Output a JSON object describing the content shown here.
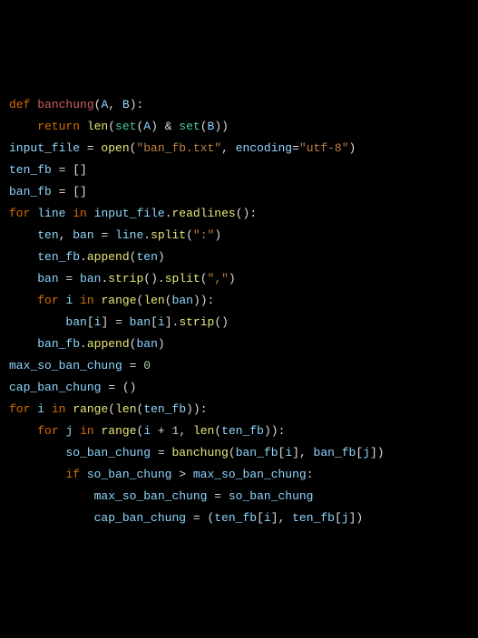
{
  "code": {
    "lines": [
      [
        {
          "cls": "kw-orange",
          "t": "def "
        },
        {
          "cls": "fn-red",
          "t": "banchung"
        },
        {
          "cls": "paren",
          "t": "("
        },
        {
          "cls": "var-teal",
          "t": "A"
        },
        {
          "cls": "ident",
          "t": ", "
        },
        {
          "cls": "var-teal",
          "t": "B"
        },
        {
          "cls": "paren",
          "t": ")"
        },
        {
          "cls": "ident",
          "t": ":"
        }
      ],
      [
        {
          "cls": "ident",
          "t": "    "
        },
        {
          "cls": "kw-orange",
          "t": "return "
        },
        {
          "cls": "fn-yellow",
          "t": "len"
        },
        {
          "cls": "paren",
          "t": "("
        },
        {
          "cls": "fn-green",
          "t": "set"
        },
        {
          "cls": "paren",
          "t": "("
        },
        {
          "cls": "var-teal",
          "t": "A"
        },
        {
          "cls": "paren",
          "t": ") "
        },
        {
          "cls": "op",
          "t": "& "
        },
        {
          "cls": "fn-green",
          "t": "set"
        },
        {
          "cls": "paren",
          "t": "("
        },
        {
          "cls": "var-teal",
          "t": "B"
        },
        {
          "cls": "paren",
          "t": "))"
        }
      ],
      [
        {
          "cls": "ident",
          "t": ""
        }
      ],
      [
        {
          "cls": "ident",
          "t": ""
        }
      ],
      [
        {
          "cls": "var-teal",
          "t": "input_file"
        },
        {
          "cls": "ident",
          "t": " = "
        },
        {
          "cls": "fn-yellow",
          "t": "open"
        },
        {
          "cls": "paren",
          "t": "("
        },
        {
          "cls": "str",
          "t": "\"ban_fb.txt\""
        },
        {
          "cls": "ident",
          "t": ", "
        },
        {
          "cls": "var-teal",
          "t": "encoding"
        },
        {
          "cls": "ident",
          "t": "="
        },
        {
          "cls": "str",
          "t": "\"utf-8\""
        },
        {
          "cls": "paren",
          "t": ")"
        }
      ],
      [
        {
          "cls": "var-teal",
          "t": "ten_fb"
        },
        {
          "cls": "ident",
          "t": " = []"
        }
      ],
      [
        {
          "cls": "var-teal",
          "t": "ban_fb"
        },
        {
          "cls": "ident",
          "t": " = []"
        }
      ],
      [
        {
          "cls": "kw-orange",
          "t": "for"
        },
        {
          "cls": "ident",
          "t": " "
        },
        {
          "cls": "var-teal",
          "t": "line"
        },
        {
          "cls": "ident",
          "t": " "
        },
        {
          "cls": "kw-orange",
          "t": "in"
        },
        {
          "cls": "ident",
          "t": " "
        },
        {
          "cls": "var-teal",
          "t": "input_file"
        },
        {
          "cls": "ident",
          "t": "."
        },
        {
          "cls": "fn-yellow",
          "t": "readlines"
        },
        {
          "cls": "paren",
          "t": "()"
        },
        {
          "cls": "ident",
          "t": ":"
        }
      ],
      [
        {
          "cls": "ident",
          "t": "    "
        },
        {
          "cls": "var-teal",
          "t": "ten"
        },
        {
          "cls": "ident",
          "t": ", "
        },
        {
          "cls": "var-teal",
          "t": "ban"
        },
        {
          "cls": "ident",
          "t": " = "
        },
        {
          "cls": "var-teal",
          "t": "line"
        },
        {
          "cls": "ident",
          "t": "."
        },
        {
          "cls": "fn-yellow",
          "t": "split"
        },
        {
          "cls": "paren",
          "t": "("
        },
        {
          "cls": "str",
          "t": "\":\""
        },
        {
          "cls": "paren",
          "t": ")"
        }
      ],
      [
        {
          "cls": "ident",
          "t": "    "
        },
        {
          "cls": "var-teal",
          "t": "ten_fb"
        },
        {
          "cls": "ident",
          "t": "."
        },
        {
          "cls": "fn-yellow",
          "t": "append"
        },
        {
          "cls": "paren",
          "t": "("
        },
        {
          "cls": "var-teal",
          "t": "ten"
        },
        {
          "cls": "paren",
          "t": ")"
        }
      ],
      [
        {
          "cls": "ident",
          "t": "    "
        },
        {
          "cls": "var-teal",
          "t": "ban"
        },
        {
          "cls": "ident",
          "t": " = "
        },
        {
          "cls": "var-teal",
          "t": "ban"
        },
        {
          "cls": "ident",
          "t": "."
        },
        {
          "cls": "fn-yellow",
          "t": "strip"
        },
        {
          "cls": "paren",
          "t": "()"
        },
        {
          "cls": "ident",
          "t": "."
        },
        {
          "cls": "fn-yellow",
          "t": "split"
        },
        {
          "cls": "paren",
          "t": "("
        },
        {
          "cls": "str",
          "t": "\",\""
        },
        {
          "cls": "paren",
          "t": ")"
        }
      ],
      [
        {
          "cls": "ident",
          "t": "    "
        },
        {
          "cls": "kw-orange",
          "t": "for"
        },
        {
          "cls": "ident",
          "t": " "
        },
        {
          "cls": "var-teal",
          "t": "i"
        },
        {
          "cls": "ident",
          "t": " "
        },
        {
          "cls": "kw-orange",
          "t": "in"
        },
        {
          "cls": "ident",
          "t": " "
        },
        {
          "cls": "fn-yellow",
          "t": "range"
        },
        {
          "cls": "paren",
          "t": "("
        },
        {
          "cls": "fn-yellow",
          "t": "len"
        },
        {
          "cls": "paren",
          "t": "("
        },
        {
          "cls": "var-teal",
          "t": "ban"
        },
        {
          "cls": "paren",
          "t": "))"
        },
        {
          "cls": "ident",
          "t": ":"
        }
      ],
      [
        {
          "cls": "ident",
          "t": "        "
        },
        {
          "cls": "var-teal",
          "t": "ban"
        },
        {
          "cls": "paren",
          "t": "["
        },
        {
          "cls": "var-teal",
          "t": "i"
        },
        {
          "cls": "paren",
          "t": "]"
        },
        {
          "cls": "ident",
          "t": " = "
        },
        {
          "cls": "var-teal",
          "t": "ban"
        },
        {
          "cls": "paren",
          "t": "["
        },
        {
          "cls": "var-teal",
          "t": "i"
        },
        {
          "cls": "paren",
          "t": "]"
        },
        {
          "cls": "ident",
          "t": "."
        },
        {
          "cls": "fn-yellow",
          "t": "strip"
        },
        {
          "cls": "paren",
          "t": "()"
        }
      ],
      [
        {
          "cls": "ident",
          "t": "    "
        },
        {
          "cls": "var-teal",
          "t": "ban_fb"
        },
        {
          "cls": "ident",
          "t": "."
        },
        {
          "cls": "fn-yellow",
          "t": "append"
        },
        {
          "cls": "paren",
          "t": "("
        },
        {
          "cls": "var-teal",
          "t": "ban"
        },
        {
          "cls": "paren",
          "t": ")"
        }
      ],
      [
        {
          "cls": "ident",
          "t": ""
        }
      ],
      [
        {
          "cls": "ident",
          "t": ""
        }
      ],
      [
        {
          "cls": "var-teal",
          "t": "max_so_ban_chung"
        },
        {
          "cls": "ident",
          "t": " = "
        },
        {
          "cls": "num",
          "t": "0"
        }
      ],
      [
        {
          "cls": "var-teal",
          "t": "cap_ban_chung"
        },
        {
          "cls": "ident",
          "t": " = ()"
        }
      ],
      [
        {
          "cls": "kw-orange",
          "t": "for"
        },
        {
          "cls": "ident",
          "t": " "
        },
        {
          "cls": "var-teal",
          "t": "i"
        },
        {
          "cls": "ident",
          "t": " "
        },
        {
          "cls": "kw-orange",
          "t": "in"
        },
        {
          "cls": "ident",
          "t": " "
        },
        {
          "cls": "fn-yellow",
          "t": "range"
        },
        {
          "cls": "paren",
          "t": "("
        },
        {
          "cls": "fn-yellow",
          "t": "len"
        },
        {
          "cls": "paren",
          "t": "("
        },
        {
          "cls": "var-teal",
          "t": "ten_fb"
        },
        {
          "cls": "paren",
          "t": "))"
        },
        {
          "cls": "ident",
          "t": ":"
        }
      ],
      [
        {
          "cls": "ident",
          "t": "    "
        },
        {
          "cls": "kw-orange",
          "t": "for"
        },
        {
          "cls": "ident",
          "t": " "
        },
        {
          "cls": "var-teal",
          "t": "j"
        },
        {
          "cls": "ident",
          "t": " "
        },
        {
          "cls": "kw-orange",
          "t": "in"
        },
        {
          "cls": "ident",
          "t": " "
        },
        {
          "cls": "fn-yellow",
          "t": "range"
        },
        {
          "cls": "paren",
          "t": "("
        },
        {
          "cls": "var-teal",
          "t": "i"
        },
        {
          "cls": "ident",
          "t": " + "
        },
        {
          "cls": "num",
          "t": "1"
        },
        {
          "cls": "ident",
          "t": ", "
        },
        {
          "cls": "fn-yellow",
          "t": "len"
        },
        {
          "cls": "paren",
          "t": "("
        },
        {
          "cls": "var-teal",
          "t": "ten_fb"
        },
        {
          "cls": "paren",
          "t": "))"
        },
        {
          "cls": "ident",
          "t": ":"
        }
      ],
      [
        {
          "cls": "ident",
          "t": "        "
        },
        {
          "cls": "var-teal",
          "t": "so_ban_chung"
        },
        {
          "cls": "ident",
          "t": " = "
        },
        {
          "cls": "fn-yellow",
          "t": "banchung"
        },
        {
          "cls": "paren",
          "t": "("
        },
        {
          "cls": "var-teal",
          "t": "ban_fb"
        },
        {
          "cls": "paren",
          "t": "["
        },
        {
          "cls": "var-teal",
          "t": "i"
        },
        {
          "cls": "paren",
          "t": "]"
        },
        {
          "cls": "ident",
          "t": ", "
        },
        {
          "cls": "var-teal",
          "t": "ban_fb"
        },
        {
          "cls": "paren",
          "t": "["
        },
        {
          "cls": "var-teal",
          "t": "j"
        },
        {
          "cls": "paren",
          "t": "])"
        }
      ],
      [
        {
          "cls": "ident",
          "t": "        "
        },
        {
          "cls": "kw-orange",
          "t": "if"
        },
        {
          "cls": "ident",
          "t": " "
        },
        {
          "cls": "var-teal",
          "t": "so_ban_chung"
        },
        {
          "cls": "ident",
          "t": " > "
        },
        {
          "cls": "var-teal",
          "t": "max_so_ban_chung"
        },
        {
          "cls": "ident",
          "t": ":"
        }
      ],
      [
        {
          "cls": "ident",
          "t": "            "
        },
        {
          "cls": "var-teal",
          "t": "max_so_ban_chung"
        },
        {
          "cls": "ident",
          "t": " = "
        },
        {
          "cls": "var-teal",
          "t": "so_ban_chung"
        }
      ],
      [
        {
          "cls": "ident",
          "t": "            "
        },
        {
          "cls": "var-teal",
          "t": "cap_ban_chung"
        },
        {
          "cls": "ident",
          "t": " = ("
        },
        {
          "cls": "var-teal",
          "t": "ten_fb"
        },
        {
          "cls": "paren",
          "t": "["
        },
        {
          "cls": "var-teal",
          "t": "i"
        },
        {
          "cls": "paren",
          "t": "]"
        },
        {
          "cls": "ident",
          "t": ", "
        },
        {
          "cls": "var-teal",
          "t": "ten_fb"
        },
        {
          "cls": "paren",
          "t": "["
        },
        {
          "cls": "var-teal",
          "t": "j"
        },
        {
          "cls": "paren",
          "t": "])"
        }
      ]
    ]
  }
}
